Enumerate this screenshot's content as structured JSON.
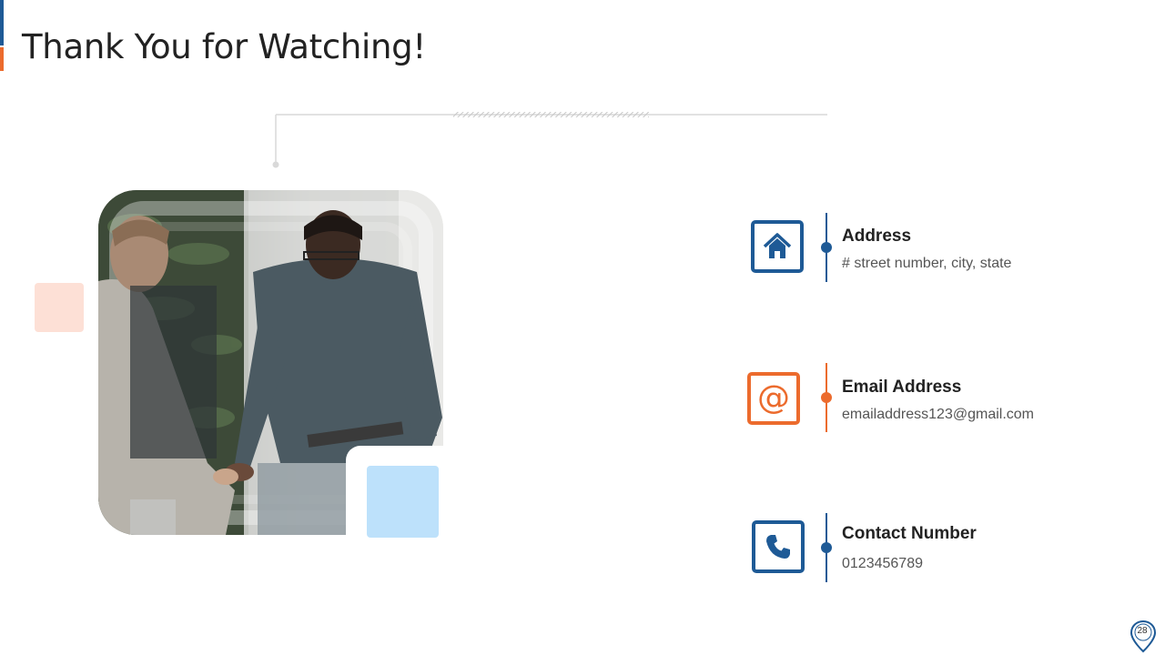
{
  "slide": {
    "title": "Thank You for Watching!",
    "page_number": "28"
  },
  "contacts": [
    {
      "label": "Address",
      "value": "# street number, city, state",
      "icon": "home-icon",
      "color": "#1e5a96"
    },
    {
      "label": "Email Address",
      "value": "emailaddress123@gmail.com",
      "icon": "at-sign-icon",
      "color": "#ec6b2d"
    },
    {
      "label": "Contact Number",
      "value": "0123456789",
      "icon": "phone-icon",
      "color": "#1e5a96"
    }
  ],
  "colors": {
    "primary_blue": "#1e5a96",
    "accent_orange": "#ec6b2d",
    "peach": "#fde0d6",
    "light_blue": "#bde1fb"
  },
  "photo": {
    "subject": "two men shaking hands in an office"
  }
}
